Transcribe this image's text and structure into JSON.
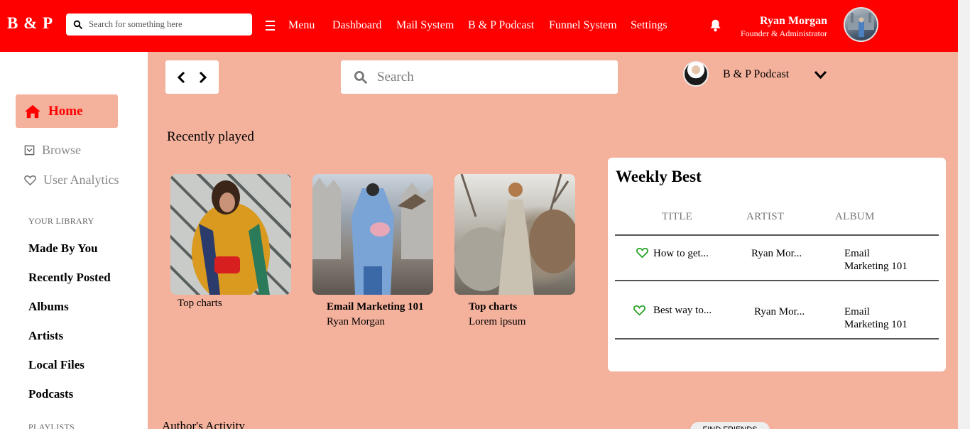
{
  "brand": "B & P",
  "top_search": {
    "placeholder": "Search for something here"
  },
  "topnav": {
    "menu": "Menu",
    "items": [
      "Dashboard",
      "Mail System",
      "B & P Podcast",
      "Funnel System",
      "Settings"
    ]
  },
  "user": {
    "name": "Ryan Morgan",
    "role": "Founder & Administrator"
  },
  "sidebar": {
    "home": "Home",
    "browse": "Browse",
    "analytics": "User Analytics",
    "library_heading": "YOUR LIBRARY",
    "library": [
      "Made By You",
      "Recently Posted",
      "Albums",
      "Artists",
      "Local Files",
      "Podcasts"
    ],
    "playlists_heading": "PLAYLISTS"
  },
  "main": {
    "search_placeholder": "Search",
    "podcast_name": "B & P Podcast",
    "recently_played_title": "Recently played",
    "cards": [
      {
        "title": "Top charts",
        "subtitle": ""
      },
      {
        "title": "Email Marketing 101",
        "subtitle": "Ryan Morgan"
      },
      {
        "title": "Top charts",
        "subtitle": "Lorem ipsum"
      }
    ],
    "author_activity": "Author's Activity",
    "find_friends": "FIND FRIENDS"
  },
  "weekly_best": {
    "title": "Weekly Best",
    "headers": [
      "TITLE",
      "ARTIST",
      "ALBUM"
    ],
    "rows": [
      {
        "title": "How to get...",
        "artist": "Ryan Mor...",
        "album_line1": "Email",
        "album_line2": "Marketing 101"
      },
      {
        "title": "Best way to...",
        "artist": "Ryan Mor...",
        "album_line1": "Email",
        "album_line2": "Marketing 101"
      }
    ]
  },
  "colors": {
    "brand_red": "#ff0000",
    "salmon": "#f4b19c",
    "heart_green": "#1e9e1e"
  }
}
